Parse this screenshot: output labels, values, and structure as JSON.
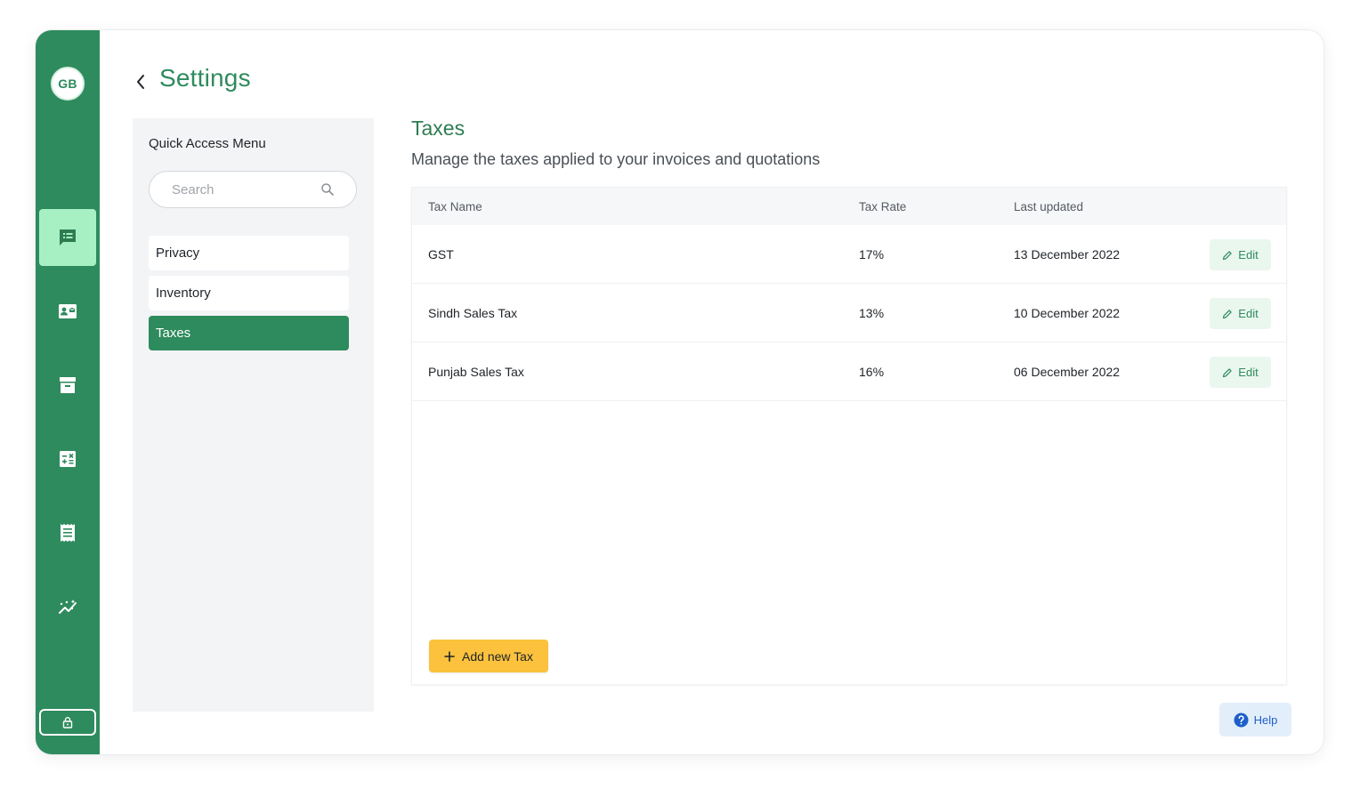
{
  "app": {
    "user_initials": "GB",
    "page_title": "Settings"
  },
  "sidebar": {
    "nav": [
      {
        "icon": "chat-list-icon",
        "active": true
      },
      {
        "icon": "contact-card-icon",
        "active": false
      },
      {
        "icon": "archive-box-icon",
        "active": false
      },
      {
        "icon": "calculator-icon",
        "active": false
      },
      {
        "icon": "receipt-icon",
        "active": false
      },
      {
        "icon": "analytics-icon",
        "active": false
      }
    ],
    "bottom_icon": "lock-icon"
  },
  "quick_access": {
    "title": "Quick Access Menu",
    "search_placeholder": "Search",
    "items": [
      {
        "label": "Privacy",
        "active": false
      },
      {
        "label": "Inventory",
        "active": false
      },
      {
        "label": "Taxes",
        "active": true
      }
    ]
  },
  "taxes": {
    "title": "Taxes",
    "subtitle": "Manage the taxes applied to your invoices and quotations",
    "columns": [
      "Tax Name",
      "Tax Rate",
      "Last updated"
    ],
    "rows": [
      {
        "name": "GST",
        "rate": "17%",
        "updated": "13 December 2022",
        "action": "Edit"
      },
      {
        "name": "Sindh Sales Tax",
        "rate": "13%",
        "updated": "10 December 2022",
        "action": "Edit"
      },
      {
        "name": "Punjab Sales Tax",
        "rate": "16%",
        "updated": "06 December 2022",
        "action": "Edit"
      }
    ],
    "add_label": "Add new Tax"
  },
  "help": {
    "label": "Help"
  },
  "colors": {
    "brand_green": "#2e8b5d",
    "active_nav": "#a7f0c4",
    "add_button": "#fcc23d",
    "help_blue": "#1d5fc9"
  }
}
